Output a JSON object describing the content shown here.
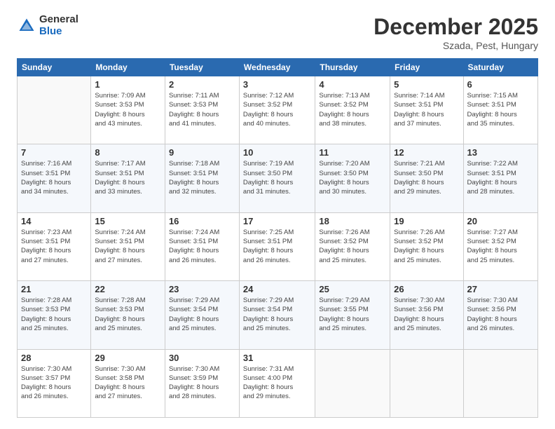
{
  "header": {
    "logo_general": "General",
    "logo_blue": "Blue",
    "month": "December 2025",
    "location": "Szada, Pest, Hungary"
  },
  "days_of_week": [
    "Sunday",
    "Monday",
    "Tuesday",
    "Wednesday",
    "Thursday",
    "Friday",
    "Saturday"
  ],
  "weeks": [
    [
      {
        "day": "",
        "info": ""
      },
      {
        "day": "1",
        "info": "Sunrise: 7:09 AM\nSunset: 3:53 PM\nDaylight: 8 hours\nand 43 minutes."
      },
      {
        "day": "2",
        "info": "Sunrise: 7:11 AM\nSunset: 3:53 PM\nDaylight: 8 hours\nand 41 minutes."
      },
      {
        "day": "3",
        "info": "Sunrise: 7:12 AM\nSunset: 3:52 PM\nDaylight: 8 hours\nand 40 minutes."
      },
      {
        "day": "4",
        "info": "Sunrise: 7:13 AM\nSunset: 3:52 PM\nDaylight: 8 hours\nand 38 minutes."
      },
      {
        "day": "5",
        "info": "Sunrise: 7:14 AM\nSunset: 3:51 PM\nDaylight: 8 hours\nand 37 minutes."
      },
      {
        "day": "6",
        "info": "Sunrise: 7:15 AM\nSunset: 3:51 PM\nDaylight: 8 hours\nand 35 minutes."
      }
    ],
    [
      {
        "day": "7",
        "info": "Sunrise: 7:16 AM\nSunset: 3:51 PM\nDaylight: 8 hours\nand 34 minutes."
      },
      {
        "day": "8",
        "info": "Sunrise: 7:17 AM\nSunset: 3:51 PM\nDaylight: 8 hours\nand 33 minutes."
      },
      {
        "day": "9",
        "info": "Sunrise: 7:18 AM\nSunset: 3:51 PM\nDaylight: 8 hours\nand 32 minutes."
      },
      {
        "day": "10",
        "info": "Sunrise: 7:19 AM\nSunset: 3:50 PM\nDaylight: 8 hours\nand 31 minutes."
      },
      {
        "day": "11",
        "info": "Sunrise: 7:20 AM\nSunset: 3:50 PM\nDaylight: 8 hours\nand 30 minutes."
      },
      {
        "day": "12",
        "info": "Sunrise: 7:21 AM\nSunset: 3:50 PM\nDaylight: 8 hours\nand 29 minutes."
      },
      {
        "day": "13",
        "info": "Sunrise: 7:22 AM\nSunset: 3:51 PM\nDaylight: 8 hours\nand 28 minutes."
      }
    ],
    [
      {
        "day": "14",
        "info": "Sunrise: 7:23 AM\nSunset: 3:51 PM\nDaylight: 8 hours\nand 27 minutes."
      },
      {
        "day": "15",
        "info": "Sunrise: 7:24 AM\nSunset: 3:51 PM\nDaylight: 8 hours\nand 27 minutes."
      },
      {
        "day": "16",
        "info": "Sunrise: 7:24 AM\nSunset: 3:51 PM\nDaylight: 8 hours\nand 26 minutes."
      },
      {
        "day": "17",
        "info": "Sunrise: 7:25 AM\nSunset: 3:51 PM\nDaylight: 8 hours\nand 26 minutes."
      },
      {
        "day": "18",
        "info": "Sunrise: 7:26 AM\nSunset: 3:52 PM\nDaylight: 8 hours\nand 25 minutes."
      },
      {
        "day": "19",
        "info": "Sunrise: 7:26 AM\nSunset: 3:52 PM\nDaylight: 8 hours\nand 25 minutes."
      },
      {
        "day": "20",
        "info": "Sunrise: 7:27 AM\nSunset: 3:52 PM\nDaylight: 8 hours\nand 25 minutes."
      }
    ],
    [
      {
        "day": "21",
        "info": "Sunrise: 7:28 AM\nSunset: 3:53 PM\nDaylight: 8 hours\nand 25 minutes."
      },
      {
        "day": "22",
        "info": "Sunrise: 7:28 AM\nSunset: 3:53 PM\nDaylight: 8 hours\nand 25 minutes."
      },
      {
        "day": "23",
        "info": "Sunrise: 7:29 AM\nSunset: 3:54 PM\nDaylight: 8 hours\nand 25 minutes."
      },
      {
        "day": "24",
        "info": "Sunrise: 7:29 AM\nSunset: 3:54 PM\nDaylight: 8 hours\nand 25 minutes."
      },
      {
        "day": "25",
        "info": "Sunrise: 7:29 AM\nSunset: 3:55 PM\nDaylight: 8 hours\nand 25 minutes."
      },
      {
        "day": "26",
        "info": "Sunrise: 7:30 AM\nSunset: 3:56 PM\nDaylight: 8 hours\nand 25 minutes."
      },
      {
        "day": "27",
        "info": "Sunrise: 7:30 AM\nSunset: 3:56 PM\nDaylight: 8 hours\nand 26 minutes."
      }
    ],
    [
      {
        "day": "28",
        "info": "Sunrise: 7:30 AM\nSunset: 3:57 PM\nDaylight: 8 hours\nand 26 minutes."
      },
      {
        "day": "29",
        "info": "Sunrise: 7:30 AM\nSunset: 3:58 PM\nDaylight: 8 hours\nand 27 minutes."
      },
      {
        "day": "30",
        "info": "Sunrise: 7:30 AM\nSunset: 3:59 PM\nDaylight: 8 hours\nand 28 minutes."
      },
      {
        "day": "31",
        "info": "Sunrise: 7:31 AM\nSunset: 4:00 PM\nDaylight: 8 hours\nand 29 minutes."
      },
      {
        "day": "",
        "info": ""
      },
      {
        "day": "",
        "info": ""
      },
      {
        "day": "",
        "info": ""
      }
    ]
  ]
}
